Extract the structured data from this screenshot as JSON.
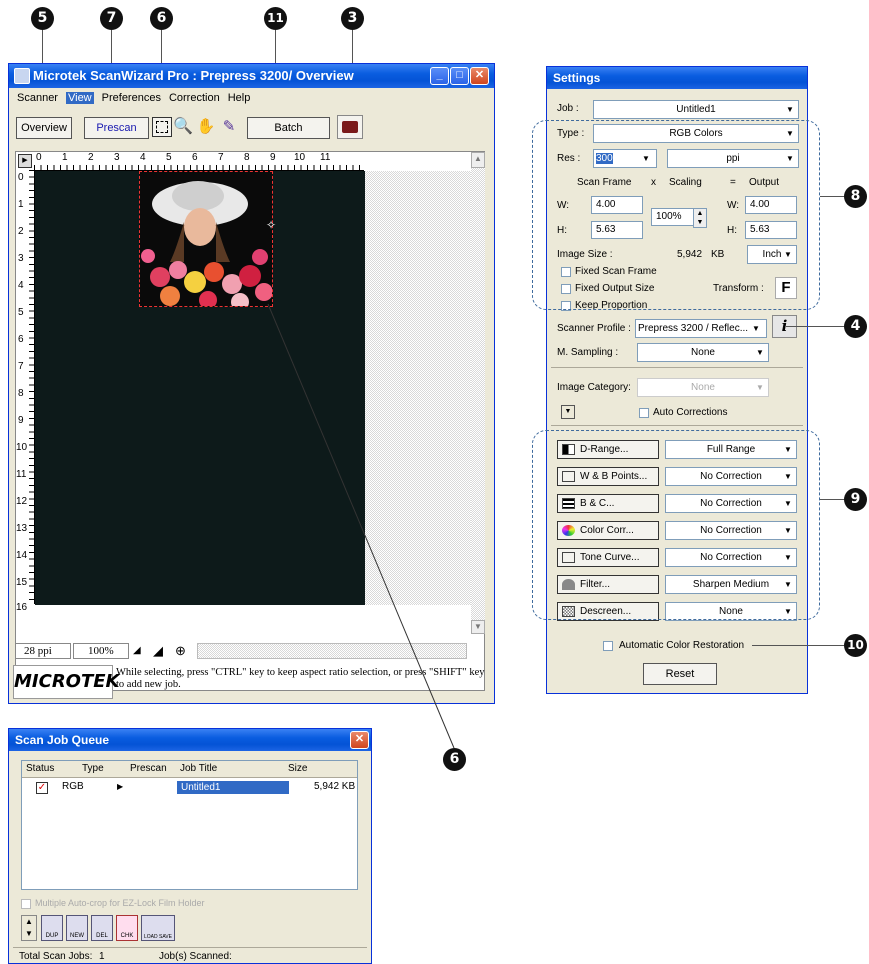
{
  "callouts": {
    "c5": "5",
    "c7": "7",
    "c6a": "6",
    "c11": "11",
    "c3": "3",
    "c8": "8",
    "c4": "4",
    "c9": "9",
    "c10": "10",
    "c6b": "6"
  },
  "main_window": {
    "title": "Microtek ScanWizard Pro : Prepress 3200/ Overview",
    "menu": [
      "Scanner",
      "View",
      "Preferences",
      "Correction",
      "Help"
    ],
    "overview_label": "Overview",
    "prescan_label": "Prescan",
    "batch_label": "Batch",
    "ruler_h": [
      "0",
      "1",
      "2",
      "3",
      "4",
      "5",
      "6",
      "7",
      "8",
      "9",
      "10",
      "11"
    ],
    "ruler_v": [
      "0",
      "1",
      "2",
      "3",
      "4",
      "5",
      "6",
      "7",
      "8",
      "9",
      "10",
      "11",
      "12",
      "13",
      "14",
      "15",
      "16"
    ],
    "status_ppi": "28 ppi",
    "status_zoom": "100%",
    "brand": "MICROTEK",
    "hint": "While selecting, press \"CTRL\" key to keep aspect ratio selection, or press \"SHIFT\" key to add new job."
  },
  "settings": {
    "title": "Settings",
    "job_label": "Job :",
    "job_value": "Untitled1",
    "type_label": "Type :",
    "type_value": "RGB Colors",
    "res_label": "Res :",
    "res_value": "300",
    "res_unit": "ppi",
    "scan_frame": "Scan Frame",
    "x": "x",
    "scaling": "Scaling",
    "eq": "=",
    "output": "Output",
    "w_label": "W:",
    "h_label": "H:",
    "w_in": "4.00",
    "h_in": "5.63",
    "scale": "100%",
    "w_out": "4.00",
    "h_out": "5.63",
    "image_size_label": "Image Size :",
    "image_size": "5,942",
    "image_size_unit": "KB",
    "size_unit": "Inch",
    "fixed_scan_frame": "Fixed Scan Frame",
    "fixed_output_size": "Fixed Output Size",
    "transform_label": "Transform :",
    "transform_value": "F",
    "keep_proportion": "Keep Proportion",
    "scanner_profile_label": "Scanner Profile :",
    "scanner_profile": "Prepress 3200 / Reflec...",
    "info": "i",
    "msampling_label": "M. Sampling :",
    "msampling": "None",
    "image_category_label": "Image Category:",
    "image_category": "None",
    "auto_corrections": "Auto Corrections",
    "corrections": [
      {
        "label": "D-Range...",
        "value": "Full Range"
      },
      {
        "label": "W & B Points...",
        "value": "No Correction"
      },
      {
        "label": "B & C...",
        "value": "No Correction"
      },
      {
        "label": "Color Corr...",
        "value": "No Correction"
      },
      {
        "label": "Tone Curve...",
        "value": "No Correction"
      },
      {
        "label": "Filter...",
        "value": "Sharpen Medium"
      },
      {
        "label": "Descreen...",
        "value": "None"
      }
    ],
    "auto_color_restoration": "Automatic Color Restoration",
    "reset": "Reset"
  },
  "queue": {
    "title": "Scan Job Queue",
    "columns": [
      "Status",
      "Type",
      "Prescan",
      "Job Title",
      "Size"
    ],
    "row": {
      "type": "RGB",
      "title": "Untitled1",
      "size": "5,942 KB"
    },
    "multi_autocrop": "Multiple Auto-crop for EZ-Lock Film Holder",
    "tools": [
      "DUP",
      "NEW",
      "DEL",
      "CHK",
      "LOAD SAVE"
    ],
    "total_label": "Total Scan Jobs:",
    "total": "1",
    "scanned_label": "Job(s) Scanned:"
  }
}
